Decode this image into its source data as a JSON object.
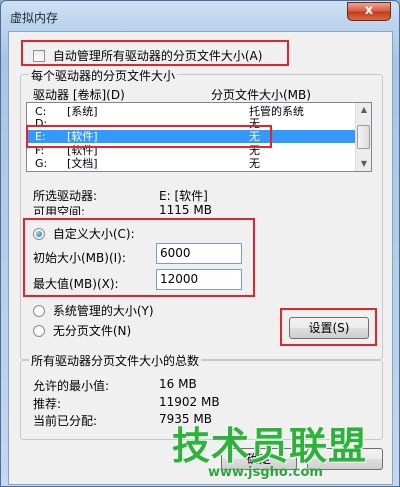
{
  "window": {
    "title": "虚拟内存",
    "close_label": "x"
  },
  "auto_manage": {
    "label": "自动管理所有驱动器的分页文件大小(A)",
    "checked": false
  },
  "drives_group": {
    "legend": "每个驱动器的分页文件大小",
    "col_drive": "驱动器 [卷标](D)",
    "col_size": "分页文件大小(MB)",
    "rows": [
      {
        "drive": "C:",
        "label": "[系统]",
        "size": "托管的系统"
      },
      {
        "drive": "D:",
        "label": "",
        "size": "无"
      },
      {
        "drive": "E:",
        "label": "[软件]",
        "size": "无"
      },
      {
        "drive": "F:",
        "label": "[软件]",
        "size": "无"
      },
      {
        "drive": "G:",
        "label": "[文档]",
        "size": "无"
      }
    ],
    "selected_index": 2,
    "selected_drive_label": "所选驱动器:",
    "selected_drive_value": "E:  [软件]",
    "free_space_label": "可用空间:",
    "free_space_value": "1115 MB",
    "custom_size_label": "自定义大小(C):",
    "initial_size_label": "初始大小(MB)(I):",
    "initial_size_value": "6000",
    "max_size_label": "最大值(MB)(X):",
    "max_size_value": "12000",
    "system_managed_label": "系统管理的大小(Y)",
    "no_paging_label": "无分页文件(N)",
    "set_button": "设置(S)",
    "selected_radio": "custom"
  },
  "totals_group": {
    "legend": "所有驱动器分页文件大小的总数",
    "min_allowed_label": "允许的最小值:",
    "min_allowed_value": "16 MB",
    "recommended_label": "推荐:",
    "recommended_value": "11902 MB",
    "current_label": "当前已分配:",
    "current_value": "7935 MB"
  },
  "footer": {
    "ok_button": "确定"
  },
  "watermark": {
    "text": "技术员联盟",
    "url": "www.jsgho.com"
  }
}
